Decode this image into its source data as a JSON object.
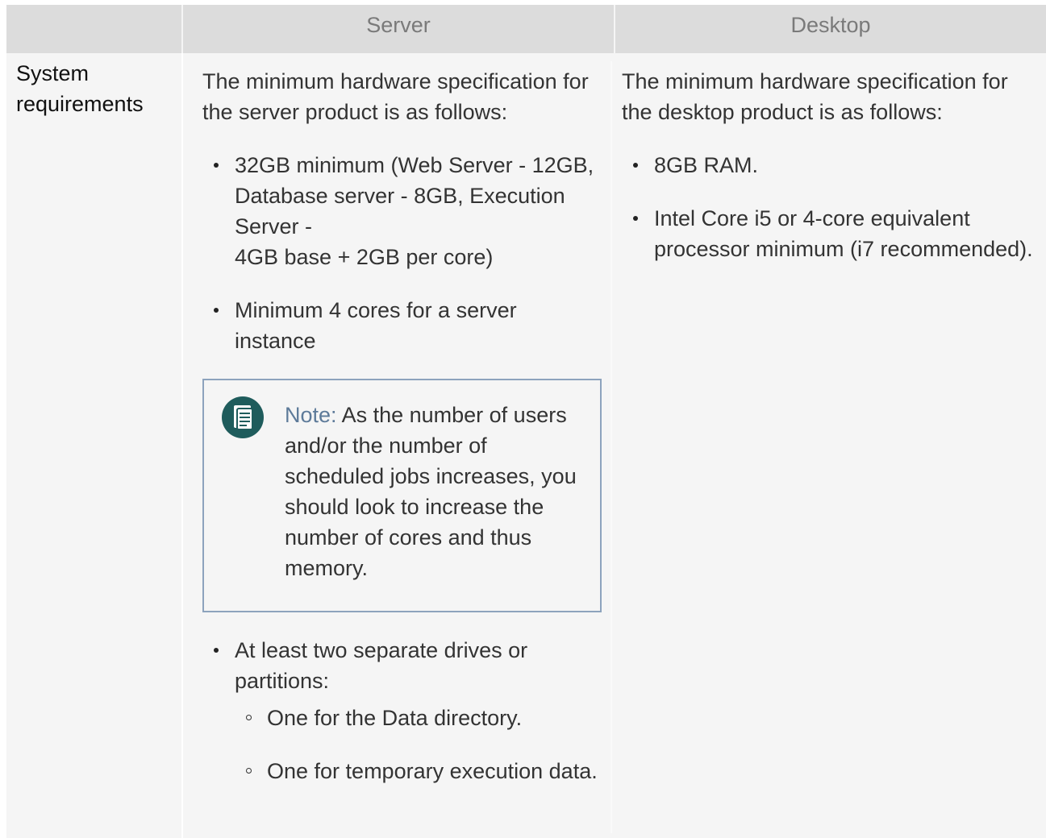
{
  "header": {
    "col_server": "Server",
    "col_desktop": "Desktop"
  },
  "row": {
    "label": "System requirements"
  },
  "server": {
    "intro": "The minimum hardware specification for the server product is as follows:",
    "bullets": [
      {
        "lines": [
          "32GB minimum (Web Server - 12GB, Database server - 8GB, Execution Server -",
          "4GB base + 2GB per core)"
        ]
      },
      {
        "text": "Minimum 4 cores for a server instance"
      }
    ],
    "note": {
      "title": "Note:",
      "text": "As the number of users and/or the number of scheduled jobs increases, you should look to increase the number of cores and thus memory.",
      "icon": "note-document-icon"
    },
    "drives": {
      "text": "At least two separate drives or partitions:",
      "items": [
        "One for the Data directory.",
        "One for temporary execution data."
      ]
    }
  },
  "desktop": {
    "intro": "The minimum hardware specification for the desktop product is as follows:",
    "bullets": [
      "8GB RAM.",
      "Intel Core i5 or 4-core equivalent processor minimum (i7 recommended)."
    ]
  },
  "colors": {
    "header_bg": "#dcdcdc",
    "header_text": "#7a7a7a",
    "body_bg": "#f5f5f5",
    "note_border": "#8da3bd",
    "note_title": "#5d7a99",
    "note_icon": "#1f5c5c"
  }
}
